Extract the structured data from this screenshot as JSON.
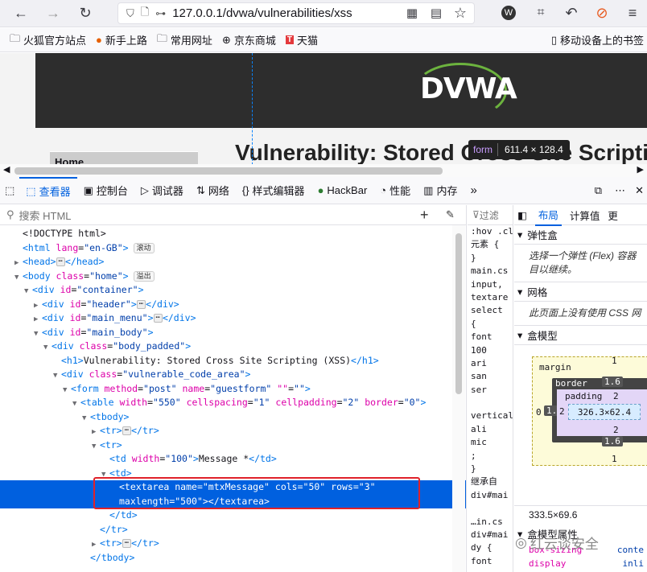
{
  "browser": {
    "url": "127.0.0.1/dvwa/vulnerabilities/xss",
    "bookmarks": [
      "火狐官方站点",
      "新手上路",
      "常用网址",
      "京东商城",
      "天猫"
    ],
    "mobile_bookmarks": "移动设备上的书签"
  },
  "page": {
    "logo": "DVWA",
    "menu_home": "Home",
    "title": "Vulnerability: Stored Cross Site Scripting",
    "tooltip_tag": "form",
    "tooltip_dims": "611.4 × 128.4"
  },
  "devtools": {
    "tabs": [
      "查看器",
      "控制台",
      "调试器",
      "网络",
      "样式编辑器",
      "HackBar",
      "性能",
      "内存"
    ],
    "search_placeholder": "搜索 HTML",
    "tree": [
      {
        "indent": 0,
        "twisty": "",
        "parts": [
          [
            "txt",
            "<!DOCTYPE html>"
          ]
        ]
      },
      {
        "indent": 0,
        "twisty": "",
        "parts": [
          [
            "tg",
            "<html"
          ],
          [
            "an",
            " lang"
          ],
          [
            "txt",
            "="
          ],
          [
            "av",
            "\"en-GB\""
          ],
          [
            "tg",
            ">"
          ]
        ],
        "badge": "滚动"
      },
      {
        "indent": 0,
        "twisty": "▶",
        "parts": [
          [
            "tg",
            "<head>"
          ],
          [
            "dots",
            "⋯"
          ],
          [
            "tg",
            "</head>"
          ]
        ]
      },
      {
        "indent": 0,
        "twisty": "▼",
        "parts": [
          [
            "tg",
            "<body"
          ],
          [
            "an",
            " class"
          ],
          [
            "txt",
            "="
          ],
          [
            "av",
            "\"home\""
          ],
          [
            "tg",
            ">"
          ]
        ],
        "badge": "溢出"
      },
      {
        "indent": 1,
        "twisty": "▼",
        "parts": [
          [
            "tg",
            "<div"
          ],
          [
            "an",
            " id"
          ],
          [
            "txt",
            "="
          ],
          [
            "av",
            "\"container\""
          ],
          [
            "tg",
            ">"
          ]
        ]
      },
      {
        "indent": 2,
        "twisty": "▶",
        "parts": [
          [
            "tg",
            "<div"
          ],
          [
            "an",
            " id"
          ],
          [
            "txt",
            "="
          ],
          [
            "av",
            "\"header\""
          ],
          [
            "tg",
            ">"
          ],
          [
            "dots",
            "⋯"
          ],
          [
            "tg",
            "</div>"
          ]
        ]
      },
      {
        "indent": 2,
        "twisty": "▶",
        "parts": [
          [
            "tg",
            "<div"
          ],
          [
            "an",
            " id"
          ],
          [
            "txt",
            "="
          ],
          [
            "av",
            "\"main_menu\""
          ],
          [
            "tg",
            ">"
          ],
          [
            "dots",
            "⋯"
          ],
          [
            "tg",
            "</div>"
          ]
        ]
      },
      {
        "indent": 2,
        "twisty": "▼",
        "parts": [
          [
            "tg",
            "<div"
          ],
          [
            "an",
            " id"
          ],
          [
            "txt",
            "="
          ],
          [
            "av",
            "\"main_body\""
          ],
          [
            "tg",
            ">"
          ]
        ]
      },
      {
        "indent": 3,
        "twisty": "▼",
        "parts": [
          [
            "tg",
            "<div"
          ],
          [
            "an",
            " class"
          ],
          [
            "txt",
            "="
          ],
          [
            "av",
            "\"body_padded\""
          ],
          [
            "tg",
            ">"
          ]
        ]
      },
      {
        "indent": 4,
        "twisty": "",
        "parts": [
          [
            "tg",
            "<h1>"
          ],
          [
            "txt",
            "Vulnerability: Stored Cross Site Scripting (XSS)"
          ],
          [
            "tg",
            "</h1>"
          ]
        ]
      },
      {
        "indent": 4,
        "twisty": "▼",
        "parts": [
          [
            "tg",
            "<div"
          ],
          [
            "an",
            " class"
          ],
          [
            "txt",
            "="
          ],
          [
            "av",
            "\"vulnerable_code_area\""
          ],
          [
            "tg",
            ">"
          ]
        ]
      },
      {
        "indent": 5,
        "twisty": "▼",
        "parts": [
          [
            "tg",
            "<form"
          ],
          [
            "an",
            " method"
          ],
          [
            "txt",
            "="
          ],
          [
            "av",
            "\"post\""
          ],
          [
            "an",
            " name"
          ],
          [
            "txt",
            "="
          ],
          [
            "av",
            "\"guestform\""
          ],
          [
            "txt",
            " "
          ],
          [
            "an",
            "\"\""
          ],
          [
            "txt",
            "="
          ],
          [
            "av",
            "\"\""
          ],
          [
            "tg",
            ">"
          ]
        ]
      },
      {
        "indent": 6,
        "twisty": "▼",
        "parts": [
          [
            "tg",
            "<table"
          ],
          [
            "an",
            " width"
          ],
          [
            "txt",
            "="
          ],
          [
            "av",
            "\"550\""
          ],
          [
            "an",
            " cellspacing"
          ],
          [
            "txt",
            "="
          ],
          [
            "av",
            "\"1\""
          ],
          [
            "an",
            " cellpadding"
          ],
          [
            "txt",
            "="
          ],
          [
            "av",
            "\"2\""
          ],
          [
            "an",
            " border"
          ],
          [
            "txt",
            "="
          ],
          [
            "av",
            "\"0\""
          ],
          [
            "tg",
            ">"
          ]
        ]
      },
      {
        "indent": 7,
        "twisty": "▼",
        "parts": [
          [
            "tg",
            "<tbody>"
          ]
        ]
      },
      {
        "indent": 8,
        "twisty": "▶",
        "parts": [
          [
            "tg",
            "<tr>"
          ],
          [
            "dots",
            "⋯"
          ],
          [
            "tg",
            "</tr>"
          ]
        ]
      },
      {
        "indent": 8,
        "twisty": "▼",
        "parts": [
          [
            "tg",
            "<tr>"
          ]
        ]
      },
      {
        "indent": 9,
        "twisty": "",
        "parts": [
          [
            "tg",
            "<td"
          ],
          [
            "an",
            " width"
          ],
          [
            "txt",
            "="
          ],
          [
            "av",
            "\"100\""
          ],
          [
            "tg",
            ">"
          ],
          [
            "txt",
            "Message *"
          ],
          [
            "tg",
            "</td>"
          ]
        ]
      },
      {
        "indent": 9,
        "twisty": "▼",
        "parts": [
          [
            "tg",
            "<td>"
          ]
        ]
      },
      {
        "indent": 10,
        "twisty": "",
        "sel": true,
        "parts": [
          [
            "tg",
            "<textarea"
          ],
          [
            "an",
            " name"
          ],
          [
            "txt",
            "="
          ],
          [
            "av",
            "\"mtxMessage\""
          ],
          [
            "an",
            " cols"
          ],
          [
            "txt",
            "="
          ],
          [
            "av",
            "\"50\""
          ],
          [
            "an",
            " rows"
          ],
          [
            "txt",
            "="
          ],
          [
            "av",
            "\"3\""
          ]
        ]
      },
      {
        "indent": 10,
        "twisty": "",
        "sel": true,
        "parts": [
          [
            "an",
            "maxlength"
          ],
          [
            "txt",
            "="
          ],
          [
            "av",
            "\"500\""
          ],
          [
            "tg",
            "></textarea>"
          ]
        ]
      },
      {
        "indent": 9,
        "twisty": "",
        "parts": [
          [
            "tg",
            "</td>"
          ]
        ]
      },
      {
        "indent": 8,
        "twisty": "",
        "parts": [
          [
            "tg",
            "</tr>"
          ]
        ]
      },
      {
        "indent": 8,
        "twisty": "▶",
        "parts": [
          [
            "tg",
            "<tr>"
          ],
          [
            "dots",
            "⋯"
          ],
          [
            "tg",
            "</tr>"
          ]
        ]
      },
      {
        "indent": 7,
        "twisty": "",
        "parts": [
          [
            "tg",
            "</tbody>"
          ]
        ]
      }
    ],
    "rules": {
      "filter_placeholder": "过滤",
      "lines": [
        ":hov .cl",
        "元素 {",
        "}",
        "main.cs",
        "input,",
        "textare",
        "select",
        "{",
        "font",
        "100",
        "ari",
        "san",
        "ser",
        "",
        "vertical",
        "ali",
        "mic",
        ";",
        "}",
        "继承自",
        "div#mai",
        "",
        "…in.cs",
        "div#mai",
        "dy {",
        "font"
      ]
    },
    "layout": {
      "tabs": [
        "布局",
        "计算值",
        "更"
      ],
      "flex_title": "弹性盒",
      "flex_text": "选择一个弹性 (Flex) 容器目以继续。",
      "grid_title": "网格",
      "grid_text": "此页面上没有使用 CSS 网",
      "boxmodel_title": "盒模型",
      "margin_label": "margin",
      "border_label": "border",
      "padding_label": "padding",
      "margin_top": "1",
      "margin_bottom": "1",
      "margin_left": "0",
      "border_top": "1.6",
      "border_bottom": "1.6",
      "border_left": "1.6",
      "padding_top": "2",
      "padding_bottom": "2",
      "padding_left": "2",
      "content": "326.3×62.4",
      "size": "333.5×69.6",
      "props_title": "盒模型属性",
      "prop1": "box-sizing",
      "prop1_val": "conte",
      "prop2": "display",
      "prop2_val": "inli"
    }
  },
  "watermark": "红云谈安全"
}
